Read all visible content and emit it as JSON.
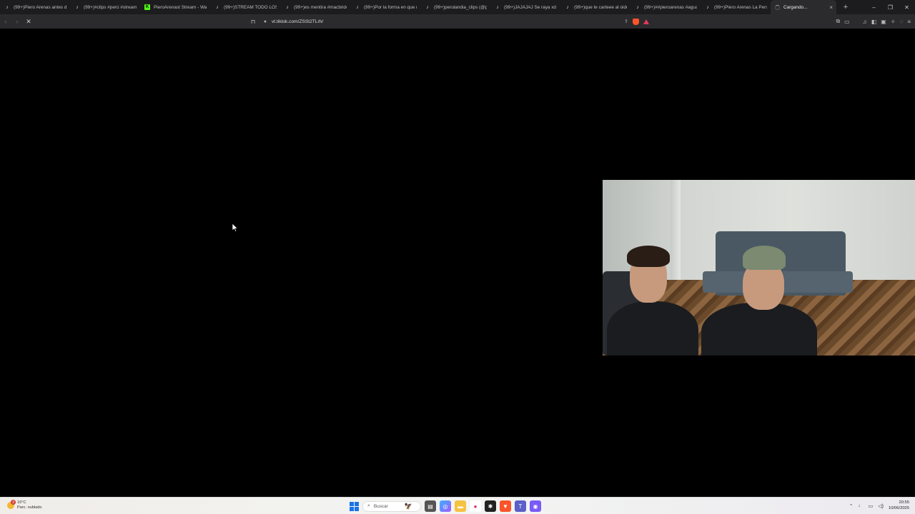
{
  "tabs": [
    {
      "favicon": "tiktok-icon",
      "title": "(99+)Piero Arenas antes de"
    },
    {
      "favicon": "tiktok-icon",
      "title": "(99+)#clips #perú #stream"
    },
    {
      "favicon": "kick-icon",
      "title": "PieroArenast Stream - Wat"
    },
    {
      "favicon": "tiktok-icon",
      "title": "(99+)STREAM TODO LOS D"
    },
    {
      "favicon": "tiktok-icon",
      "title": "(99+)es mentira #macbride"
    },
    {
      "favicon": "tiktok-icon",
      "title": "(99+)Por la forma en que n"
    },
    {
      "favicon": "tiktok-icon",
      "title": "(99+)perulandia_clips (@pe"
    },
    {
      "favicon": "tiktok-icon",
      "title": "(99+)JAJAJAJ Se raya xd #"
    },
    {
      "favicon": "tiktok-icon",
      "title": "(99+)que te carteee al oido"
    },
    {
      "favicon": "tiktok-icon",
      "title": "(99+)##pieroarenas #agua"
    },
    {
      "favicon": "tiktok-icon",
      "title": "(99+)Piero Arenas La Pers"
    }
  ],
  "active_tab": {
    "favicon": "loading-spinner-icon",
    "title": "Cargando...",
    "close": "×"
  },
  "new_tab": "+",
  "window_controls": {
    "minimize": "–",
    "restore": "❐",
    "close": "✕"
  },
  "nav": {
    "back": "‹",
    "forward": "›",
    "reload": "✕"
  },
  "address": {
    "url": "vt.tiktok.com/ZSSt2TLrh/"
  },
  "taskbar": {
    "weather_temp": "16°C",
    "weather_desc": "Parc. nublado",
    "weather_badge": "3",
    "search_placeholder": "Buscar",
    "time": "20:55",
    "date": "10/06/2025"
  },
  "colors": {
    "accent": "#1a73e8",
    "brave": "#fb542b",
    "kick": "#53fc18"
  }
}
